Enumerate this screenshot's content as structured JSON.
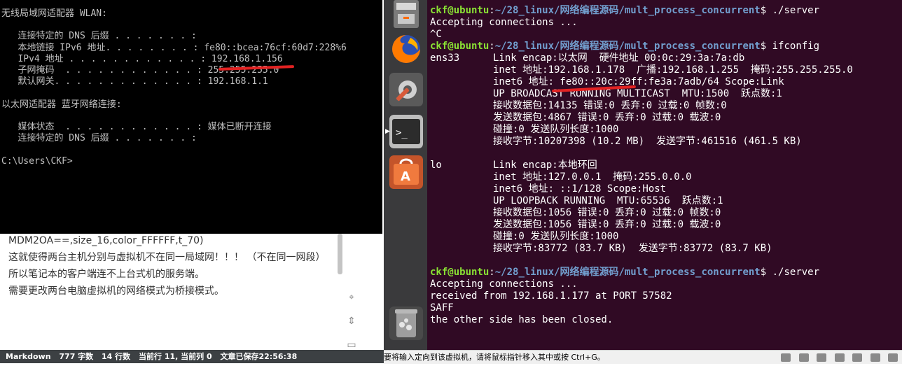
{
  "cmd_window": {
    "lines": [
      "无线局域网适配器 WLAN:",
      "",
      "   连接特定的 DNS 后缀 . . . . . . . :",
      "   本地链接 IPv6 地址. . . . . . . . : fe80::bcea:76cf:60d7:228%6",
      "   IPv4 地址 . . . . . . . . . . . . : 192.168.1.156",
      "   子网掩码  . . . . . . . . . . . . : 255.255.255.0",
      "   默认网关. . . . . . . . . . . . . : 192.168.1.1",
      "",
      "以太网适配器 蓝牙网络连接:",
      "",
      "   媒体状态  . . . . . . . . . . . . : 媒体已断开连接",
      "   连接特定的 DNS 后缀 . . . . . . . :",
      "",
      "C:\\Users\\CKF>"
    ]
  },
  "editor": {
    "lines": [
      "MDM2OA==,size_16,color_FFFFFF,t_70)",
      "这就使得两台主机分别与虚拟机不在同一局域网！！！ （不在同一网段）",
      "所以笔记本的客户端连不上台式机的服务端。",
      "需要更改两台电脑虚拟机的网络模式为桥接模式。"
    ],
    "statusbar": {
      "mode": "Markdown",
      "chars": "777 字数",
      "lines": "14 行数",
      "cursor": "当前行 11, 当前列 0",
      "saved": "文章已保存22:56:38"
    }
  },
  "launcher": {
    "items": [
      "files-icon",
      "firefox-icon",
      "settings-icon",
      "terminal-icon",
      "software-center-icon",
      "trash-icon"
    ]
  },
  "terminal": {
    "user": "ckf@ubuntu",
    "path": "~/28_linux/网络编程源码/mult_process_concurrent",
    "cmd1": "./server",
    "out1": "Accepting connections ...",
    "out2": "^C",
    "cmd2": "ifconfig",
    "ens33": [
      [
        "ens33",
        "Link encap:以太网  硬件地址 00:0c:29:3a:7a:db"
      ],
      [
        "",
        "inet 地址:192.168.1.178  广播:192.168.1.255  掩码:255.255.255.0"
      ],
      [
        "",
        "inet6 地址: fe80::20c:29ff:fe3a:7adb/64 Scope:Link"
      ],
      [
        "",
        "UP BROADCAST RUNNING MULTICAST  MTU:1500  跃点数:1"
      ],
      [
        "",
        "接收数据包:14135 错误:0 丢弃:0 过载:0 帧数:0"
      ],
      [
        "",
        "发送数据包:4867 错误:0 丢弃:0 过载:0 载波:0"
      ],
      [
        "",
        "碰撞:0 发送队列长度:1000"
      ],
      [
        "",
        "接收字节:10207398 (10.2 MB)  发送字节:461516 (461.5 KB)"
      ]
    ],
    "lo": [
      [
        "lo",
        "Link encap:本地环回"
      ],
      [
        "",
        "inet 地址:127.0.0.1  掩码:255.0.0.0"
      ],
      [
        "",
        "inet6 地址: ::1/128 Scope:Host"
      ],
      [
        "",
        "UP LOOPBACK RUNNING  MTU:65536  跃点数:1"
      ],
      [
        "",
        "接收数据包:1056 错误:0 丢弃:0 过载:0 帧数:0"
      ],
      [
        "",
        "发送数据包:1056 错误:0 丢弃:0 过载:0 载波:0"
      ],
      [
        "",
        "碰撞:0 发送队列长度:1000"
      ],
      [
        "",
        "接收字节:83772 (83.7 KB)  发送字节:83772 (83.7 KB)"
      ]
    ],
    "cmd3": "./server",
    "out3": "Accepting connections ...",
    "out4": "received from 192.168.1.177 at PORT 57582",
    "out5": "SAFF",
    "out6": "the other side has been closed."
  },
  "vmbar": {
    "hint": "要将输入定向到该虚拟机，请将鼠标指针移入其中或按 Ctrl+G。"
  }
}
